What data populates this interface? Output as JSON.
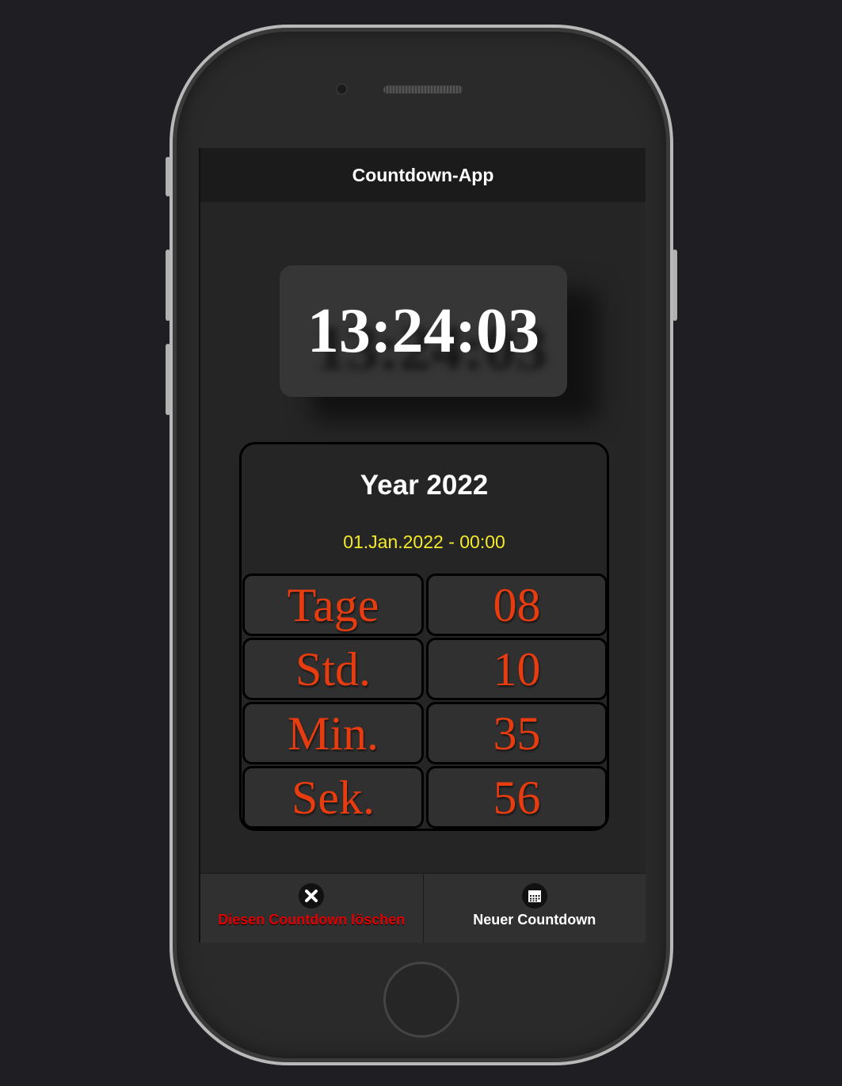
{
  "header": {
    "title": "Countdown-App"
  },
  "clock": {
    "time": "13:24:03"
  },
  "countdown": {
    "title": "Year 2022",
    "target_date": "01.Jan.2022 - 00:00",
    "rows": [
      {
        "label": "Tage",
        "value": "08"
      },
      {
        "label": "Std.",
        "value": "10"
      },
      {
        "label": "Min.",
        "value": "35"
      },
      {
        "label": "Sek.",
        "value": "56"
      }
    ]
  },
  "footer": {
    "delete_label": "Diesen Countdown löschen",
    "delete_icon": "close-circle-icon",
    "new_label": "Neuer Countdown",
    "new_icon": "calendar-icon"
  },
  "colors": {
    "accent_red": "#e63c0f",
    "date_yellow": "#f4e92a",
    "delete_red": "#e00000"
  }
}
